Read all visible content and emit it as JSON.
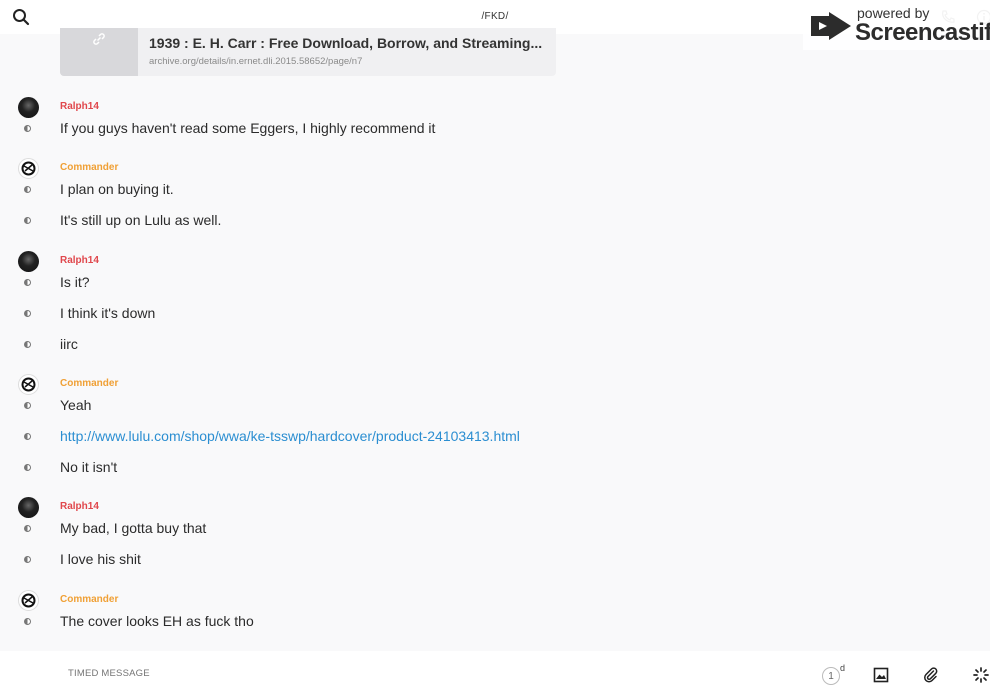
{
  "header": {
    "channel_title": "/FKD/"
  },
  "watermark": {
    "powered_by": "powered by",
    "brand": "Screencastify"
  },
  "link_preview": {
    "title": "1939 : E. H. Carr : Free Download, Borrow, and Streaming...",
    "url": "archive.org/details/in.ernet.dli.2015.58652/page/n7"
  },
  "groups": [
    {
      "author": "Ralph14",
      "messages": [
        "If you guys haven't read some Eggers, I highly recommend it"
      ]
    },
    {
      "author": "Commander",
      "messages": [
        "I plan on buying it.",
        "It's still up on Lulu as well."
      ]
    },
    {
      "author": "Ralph14",
      "messages": [
        "Is it?",
        "I think it's down",
        "iirc"
      ]
    },
    {
      "author": "Commander",
      "messages": [
        "Yeah",
        "http://www.lulu.com/shop/wwa/ke-tsswp/hardcover/product-24103413.html",
        "No it isn't"
      ]
    },
    {
      "author": "Ralph14",
      "messages": [
        "My bad, I gotta buy that",
        "I love his shit"
      ]
    },
    {
      "author": "Commander",
      "messages": [
        "The cover looks EH as fuck tho"
      ]
    }
  ],
  "composer": {
    "placeholder": "TIMED MESSAGE",
    "timer_value": "1",
    "timer_unit": "d"
  },
  "colors": {
    "ralph_name": "#e0474c",
    "commander_name": "#f0a035",
    "link": "#2b8ed1",
    "background": "#f9f9fa"
  },
  "icons": {
    "search": "search-icon",
    "phone": "phone-icon",
    "info": "info-icon",
    "image": "image-icon",
    "attach": "paperclip-icon",
    "spinner": "spinner-icon"
  }
}
